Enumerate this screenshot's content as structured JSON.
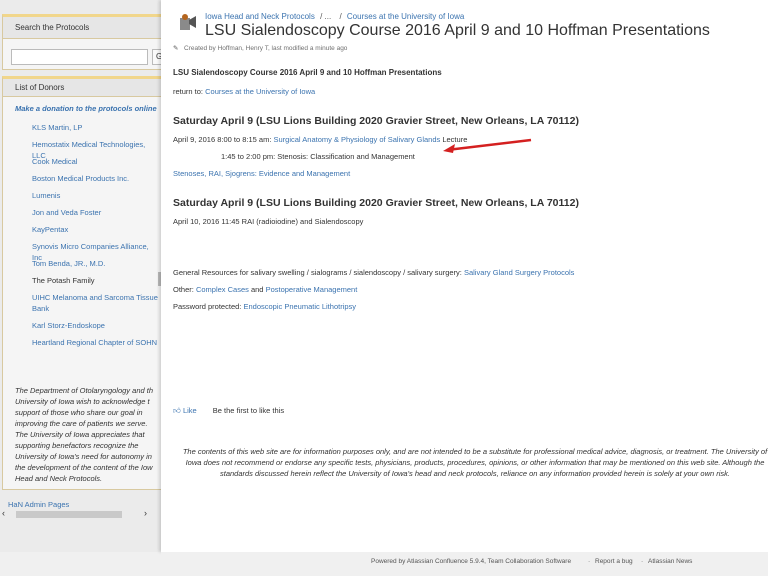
{
  "sidebar": {
    "search": {
      "heading": "Search the Protocols",
      "placeholder": "",
      "go_label": "G"
    },
    "donors": {
      "heading": "List of Donors",
      "donate_link": "Make a donation to the protocols online",
      "items": [
        "KLS Martin, LP",
        "Hemostatix Medical Technologies, LLC",
        "Cook Medical",
        "Boston Medical Products Inc.",
        "Lumenis",
        "Jon and Veda Foster",
        "KayPentax",
        "Synovis Micro Companies Alliance, Inc",
        "Tom Benda, JR., M.D.",
        "The Potash Family",
        "UIHC Melanoma and Sarcoma Tissue Bank",
        "Karl Storz-Endoskope",
        "Heartland Regional Chapter of SOHN"
      ],
      "dept_text": "The Department of Otolaryngology and th University of Iowa wish to acknowledge t support of those who share our goal in improving the care of patients we serve. The University of Iowa appreciates that supporting benefactors recognize the University of Iowa's need for autonomy in the development of the content of the Iow Head and Neck Protocols."
    },
    "admin_link": "HaN Admin Pages"
  },
  "header": {
    "breadcrumb": [
      "Iowa Head and Neck Protocols",
      "/ ...",
      "/",
      "Courses at the University of Iowa"
    ],
    "title": "LSU Sialendoscopy Course 2016 April 9 and 10 Hoffman Presentations",
    "meta": "Created by Hoffman, Henry T, last modified a minute ago"
  },
  "content": {
    "subtitle": "LSU Sialendoscopy Course 2016 April 9 and 10 Hoffman Presentations",
    "return_prefix": "return to:",
    "return_link": "Courses at the University of Iowa",
    "heading1": "Saturday April 9 (LSU Lions Building  2020 Gravier Street, New Orleans, LA 70112)",
    "line1_prefix": "April 9, 2016 8:00 to 8:15 am:",
    "line1_link": "Surgical Anatomy & Physiology of Salivary Glands",
    "line1_suffix": "Lecture",
    "line2": "1:45 to 2:00 pm: Stenosis: Classification and Management",
    "line3_link": "Stenoses, RAI, Sjogrens: Evidence and Management",
    "heading2": "Saturday April 9 (LSU Lions Building  2020 Gravier Street, New Orleans, LA 70112)",
    "line4": "April 10, 2016 11:45 RAI (radioiodine) and Sialendoscopy",
    "resources_prefix": "General Resources for salivary swelling / sialograms / sialendoscopy / salivary surgery:",
    "resources_link": "Salivary Gland Surgery Protocols",
    "other_prefix": "Other:",
    "other_link1": "Complex Cases",
    "other_and": "and",
    "other_link2": "Postoperative Management",
    "password_prefix": "Password protected:",
    "password_link": "Endoscopic Pneumatic Lithotripsy",
    "like_label": "Like",
    "like_text": "Be the first to like this",
    "disclaimer": "The contents of this web site are for information purposes only, and are not intended to be a substitute for professional medical advice, diagnosis, or treatment. The University of Iowa does not recommend or endorse any specific tests, physicians, products, procedures, opinions, or other information that may be mentioned on this web site. Although the standards discussed herein reflect the University of Iowa's head and neck protocols, reliance on any information provided herein is solely at your own risk."
  },
  "footer": {
    "powered": "Powered by Atlassian Confluence 5.9.4, Team Collaboration Software",
    "bug": "Report a bug",
    "news": "Atlassian News"
  },
  "colors": {
    "link": "#3b73af",
    "arrow": "#d42020",
    "panel_border": "#f1d68b"
  }
}
